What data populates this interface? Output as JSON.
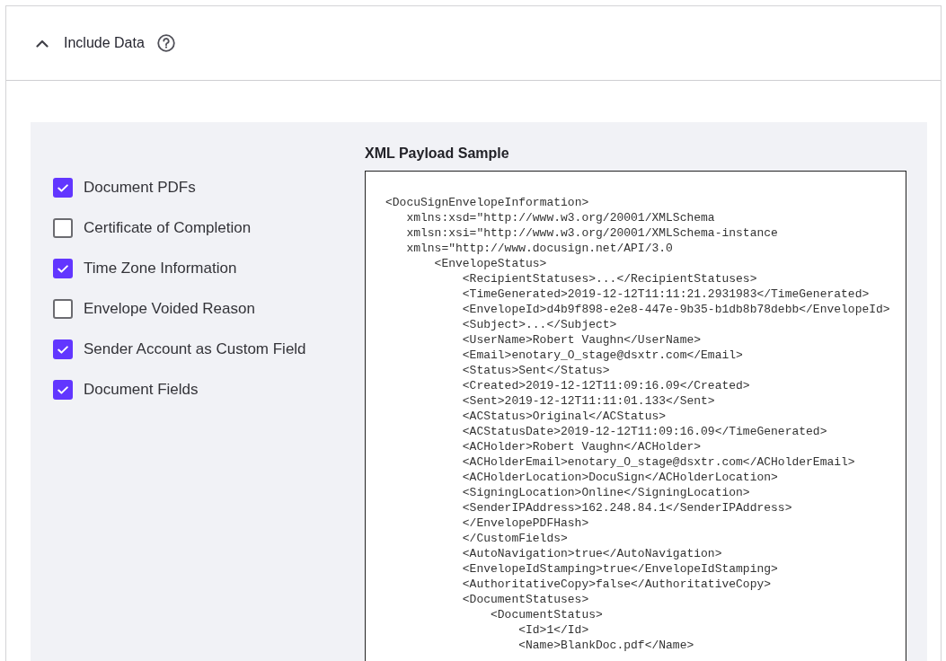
{
  "section": {
    "title": "Include Data",
    "expanded": true
  },
  "options": [
    {
      "label": "Document PDFs",
      "checked": true
    },
    {
      "label": "Certificate of Completion",
      "checked": false
    },
    {
      "label": "Time Zone Information",
      "checked": true
    },
    {
      "label": "Envelope Voided Reason",
      "checked": false
    },
    {
      "label": "Sender Account as Custom Field",
      "checked": true
    },
    {
      "label": "Document Fields",
      "checked": true
    }
  ],
  "payload": {
    "title": "XML Payload Sample",
    "lines": [
      {
        "text": "<DocuSignEnvelopeInformation>",
        "children": [
          {
            "text": "xmlns:xsd=\"http://www.w3.org/20001/XMLSchema"
          },
          {
            "text": "xmlsn:xsi=\"http://www.w3.org/20001/XMLSchema-instance"
          },
          {
            "text": "xmlns=\"http://www.docusign.net/API/3.0",
            "children": [
              {
                "text": "<EnvelopeStatus>",
                "children": [
                  {
                    "text": "<RecipientStatuses>...</RecipientStatuses>"
                  },
                  {
                    "text": "<TimeGenerated>2019-12-12T11:11:21.2931983</TimeGenerated>"
                  },
                  {
                    "text": "<EnvelopeId>d4b9f898-e2e8-447e-9b35-b1db8b78debb</EnvelopeId>"
                  },
                  {
                    "text": "<Subject>...</Subject>"
                  },
                  {
                    "text": "<UserName>Robert Vaughn</UserName>"
                  },
                  {
                    "text": "<Email>enotary_O_stage@dsxtr.com</Email>"
                  },
                  {
                    "text": "<Status>Sent</Status>"
                  },
                  {
                    "text": "<Created>2019-12-12T11:09:16.09</Created>"
                  },
                  {
                    "text": "<Sent>2019-12-12T11:11:01.133</Sent>"
                  },
                  {
                    "text": "<ACStatus>Original</ACStatus>"
                  },
                  {
                    "text": "<ACStatusDate>2019-12-12T11:09:16.09</TimeGenerated>"
                  },
                  {
                    "text": "<ACHolder>Robert Vaughn</ACHolder>"
                  },
                  {
                    "text": "<ACHolderEmail>enotary_O_stage@dsxtr.com</ACHolderEmail>"
                  },
                  {
                    "text": "<ACHolderLocation>DocuSign</ACHolderLocation>"
                  },
                  {
                    "text": "<SigningLocation>Online</SigningLocation>"
                  },
                  {
                    "text": "<SenderIPAddress>162.248.84.1</SenderIPAddress>"
                  },
                  {
                    "text": "</EnvelopePDFHash>"
                  },
                  {
                    "text": "</CustomFields>"
                  },
                  {
                    "text": "<AutoNavigation>true</AutoNavigation>"
                  },
                  {
                    "text": "<EnvelopeIdStamping>true</EnvelopeIdStamping>"
                  },
                  {
                    "text": "<AuthoritativeCopy>false</AuthoritativeCopy>"
                  },
                  {
                    "text": "<DocumentStatuses>",
                    "children": [
                      {
                        "text": "<DocumentStatus>",
                        "children": [
                          {
                            "text": "<Id>1</Id>"
                          },
                          {
                            "text": "<Name>BlankDoc.pdf</Name>"
                          }
                        ]
                      }
                    ]
                  }
                ]
              }
            ]
          }
        ]
      }
    ]
  }
}
